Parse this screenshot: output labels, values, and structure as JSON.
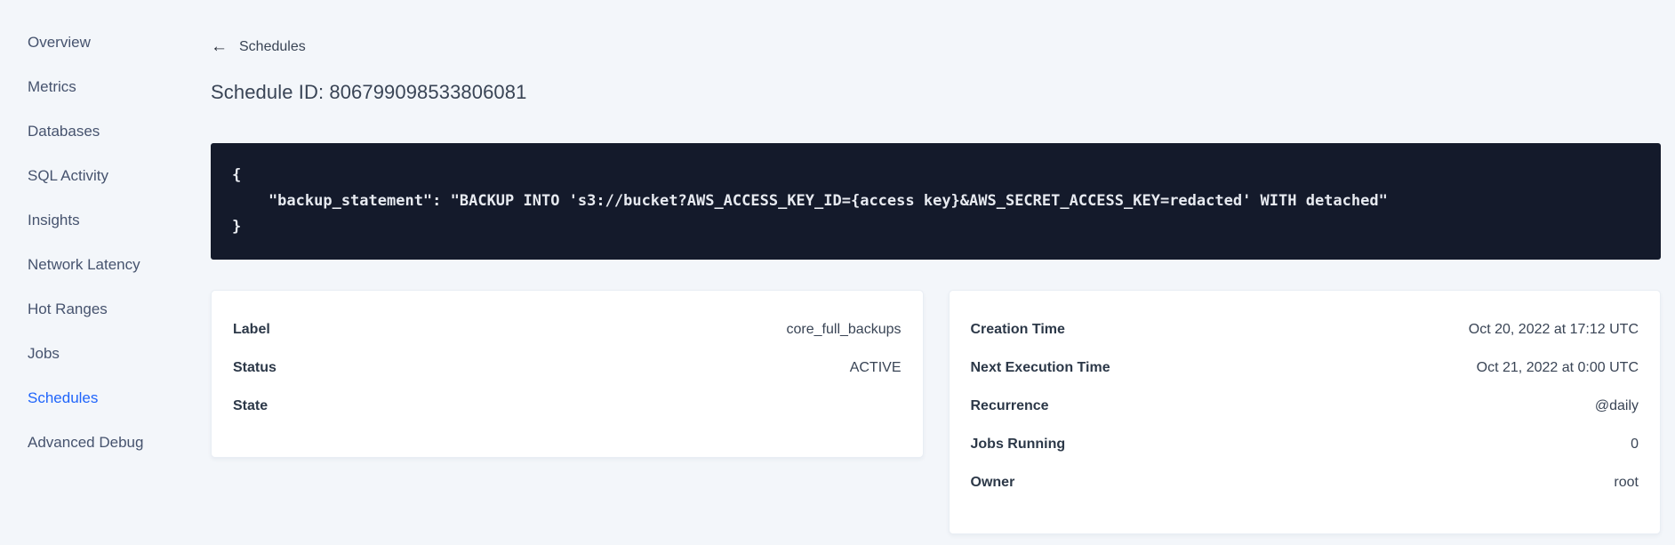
{
  "sidebar": {
    "items": [
      {
        "name": "sidebar-item-overview",
        "label": "Overview",
        "active": false
      },
      {
        "name": "sidebar-item-metrics",
        "label": "Metrics",
        "active": false
      },
      {
        "name": "sidebar-item-databases",
        "label": "Databases",
        "active": false
      },
      {
        "name": "sidebar-item-sql-activity",
        "label": "SQL Activity",
        "active": false
      },
      {
        "name": "sidebar-item-insights",
        "label": "Insights",
        "active": false
      },
      {
        "name": "sidebar-item-network-latency",
        "label": "Network Latency",
        "active": false
      },
      {
        "name": "sidebar-item-hot-ranges",
        "label": "Hot Ranges",
        "active": false
      },
      {
        "name": "sidebar-item-jobs",
        "label": "Jobs",
        "active": false
      },
      {
        "name": "sidebar-item-schedules",
        "label": "Schedules",
        "active": true
      },
      {
        "name": "sidebar-item-advanced-debug",
        "label": "Advanced Debug",
        "active": false
      }
    ]
  },
  "header": {
    "back_icon": "←",
    "back_label": "Schedules",
    "title": "Schedule ID: 806799098533806081"
  },
  "code_block": {
    "lines": [
      "{",
      "    \"backup_statement\": \"BACKUP INTO 's3://bucket?AWS_ACCESS_KEY_ID={access key}&AWS_SECRET_ACCESS_KEY=redacted' WITH detached\"",
      "}"
    ]
  },
  "details_card": {
    "rows": [
      {
        "label": "Label",
        "value": "core_full_backups"
      },
      {
        "label": "Status",
        "value": "ACTIVE"
      },
      {
        "label": "State",
        "value": ""
      }
    ]
  },
  "timing_card": {
    "rows": [
      {
        "label": "Creation Time",
        "value": "Oct 20, 2022 at 17:12 UTC"
      },
      {
        "label": "Next Execution Time",
        "value": "Oct 21, 2022 at 0:00 UTC"
      },
      {
        "label": "Recurrence",
        "value": "@daily"
      },
      {
        "label": "Jobs Running",
        "value": "0"
      },
      {
        "label": "Owner",
        "value": "root"
      }
    ]
  },
  "colors": {
    "accent": "#2065fb",
    "page_bg": "#f3f6fa",
    "code_bg": "#141a2b",
    "code_text": "#e7eaf0",
    "text": "#394455"
  }
}
